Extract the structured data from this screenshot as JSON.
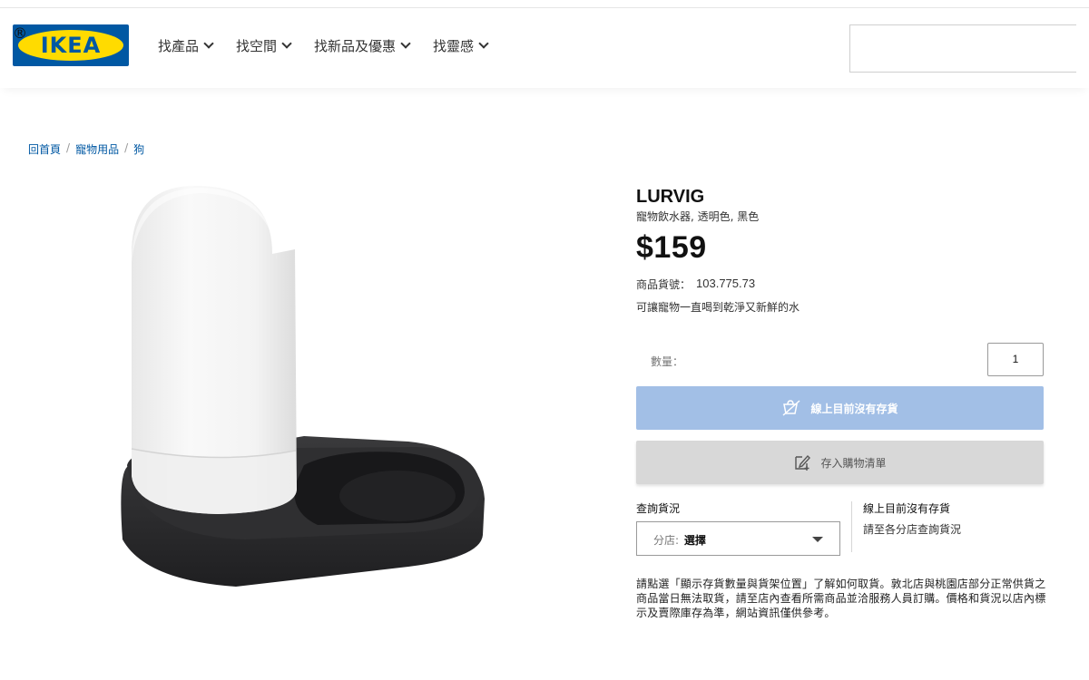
{
  "brand": {
    "logo_text": "IKEA",
    "reg_mark": "®",
    "colors": {
      "blue": "#0058a3",
      "yellow": "#ffdb00"
    }
  },
  "nav": {
    "items": [
      {
        "label": "找產品"
      },
      {
        "label": "找空間"
      },
      {
        "label": "找新品及優惠"
      },
      {
        "label": "找靈感"
      }
    ]
  },
  "search": {
    "value": "",
    "placeholder": ""
  },
  "breadcrumb": [
    "回首頁",
    "寵物用品",
    "狗"
  ],
  "product": {
    "name": "LURVIG",
    "description": "寵物飲水器, 透明色, 黑色",
    "price": "$159",
    "article_label": "商品貨號：",
    "article_number": "103.775.73",
    "tagline": "可讓寵物一直喝到乾淨又新鮮的水"
  },
  "quantity": {
    "label": "數量：",
    "value": "1"
  },
  "buttons": {
    "buy_label": "線上目前沒有存貨",
    "buy_color": "#a2bfe6",
    "wishlist_label": "存入購物清單"
  },
  "stock": {
    "title": "查詢貨況",
    "select_prefix": "分店:",
    "select_value": "選擇",
    "online_status": "線上目前沒有存貨",
    "store_hint": "請至各分店查詢貨況"
  },
  "notice": "請點選「顯示存貨數量與貨架位置」了解如何取貨。敦北店與桃園店部分正常供貨之商品當日無法取貨，請至店內查看所需商品並洽服務人員訂購。價格和貨況以店內標示及賣際庫存為準，網站資訊僅供參考。"
}
